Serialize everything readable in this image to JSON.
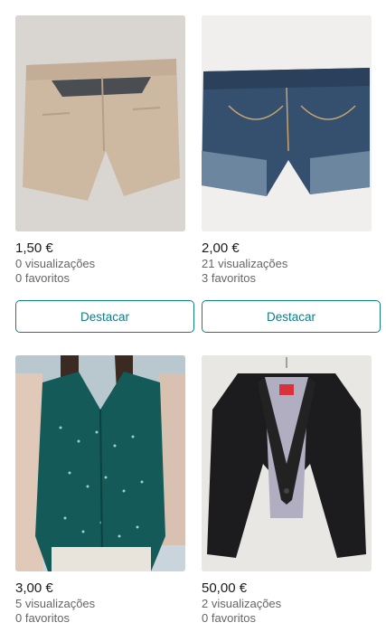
{
  "items": [
    {
      "image": "beige-chino-shorts",
      "price": "1,50 €",
      "views": "0 visualizações",
      "favorites": "0 favoritos",
      "button_label": "Destacar"
    },
    {
      "image": "denim-shorts",
      "price": "2,00 €",
      "views": "21 visualizações",
      "favorites": "3 favoritos",
      "button_label": "Destacar"
    },
    {
      "image": "teal-polka-dot-sleeveless-blouse",
      "price": "3,00 €",
      "views": "5 visualizações",
      "favorites": "0 favoritos"
    },
    {
      "image": "black-blazer",
      "price": "50,00 €",
      "views": "2 visualizações",
      "favorites": "0 favoritos"
    }
  ],
  "colors": {
    "accent": "#0f7c88",
    "meta_text": "#666666"
  }
}
